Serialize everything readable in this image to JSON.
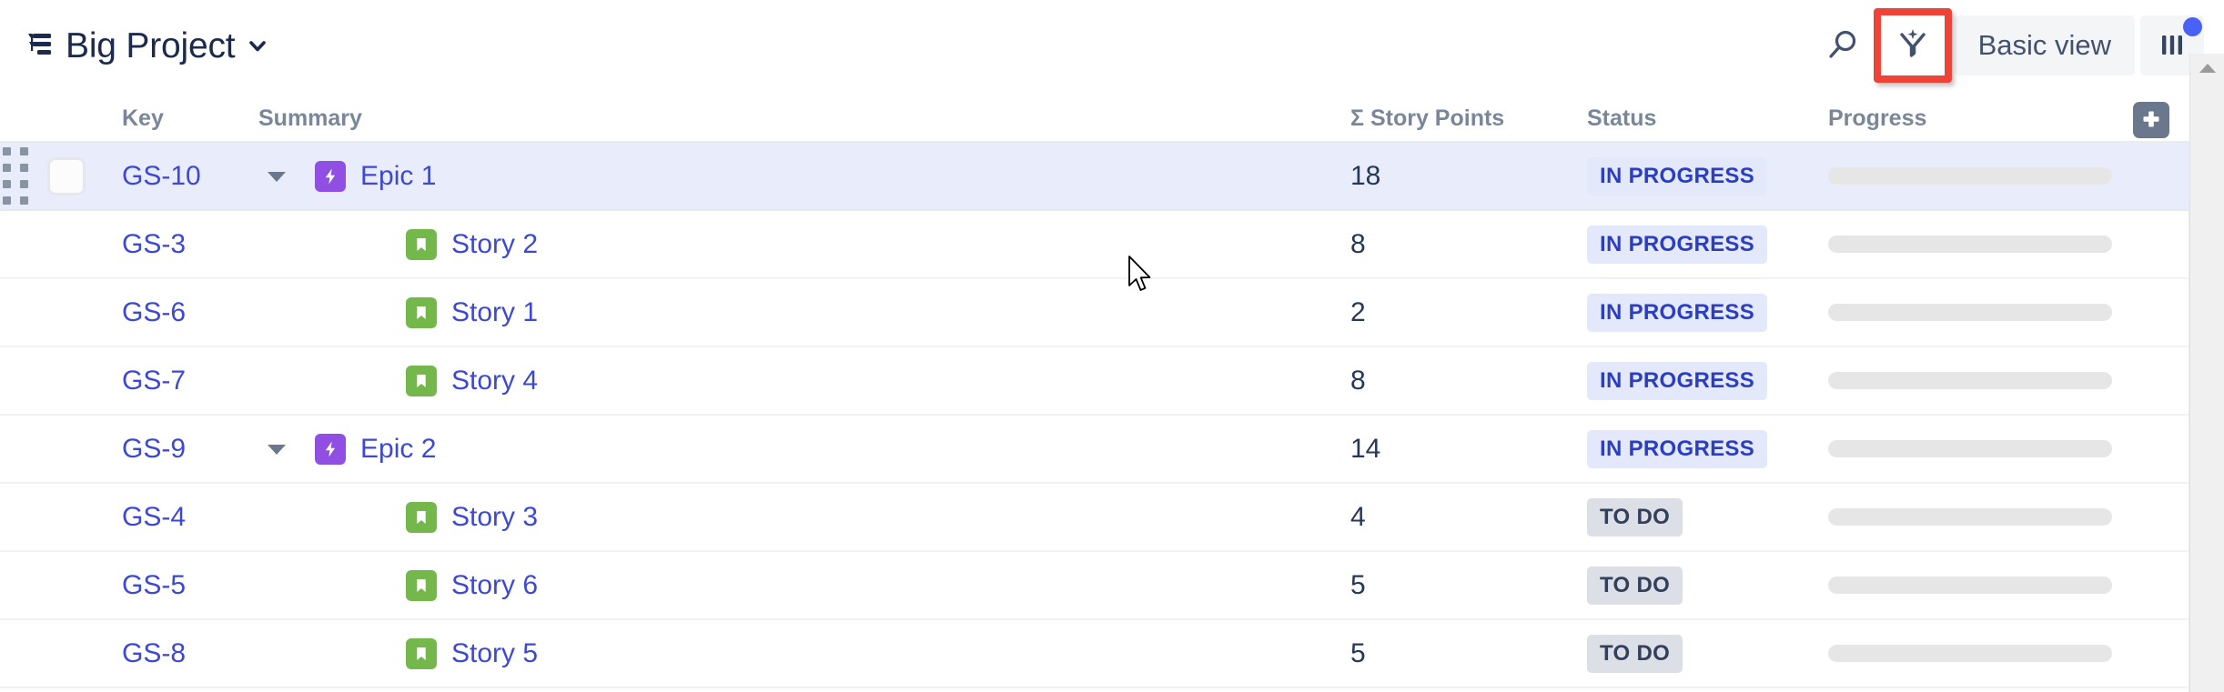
{
  "header": {
    "hierarchy_icon": "hierarchy-list-icon",
    "project_title": "Big Project",
    "title_chevron_icon": "chevron-down-icon",
    "search_icon": "search-icon",
    "filter_icon": "smart-filter-icon",
    "filter_highlight_color": "#f04337",
    "basic_view_label": "Basic view",
    "columns_icon": "columns-icon",
    "columns_badge_color": "#4762f4"
  },
  "table": {
    "columns": [
      {
        "key": "key",
        "label": "Key"
      },
      {
        "key": "summary",
        "label": "Summary"
      },
      {
        "key": "points",
        "label": "Σ Story Points"
      },
      {
        "key": "status",
        "label": "Status"
      },
      {
        "key": "progress",
        "label": "Progress"
      }
    ],
    "add_column_icon": "plus-icon",
    "rows": [
      {
        "key": "GS-10",
        "summary": "Epic 1",
        "type": "epic",
        "type_icon": "epic-bolt-icon",
        "indent": false,
        "expandable": true,
        "expander_icon": "caret-down-icon",
        "points": "18",
        "status": "IN PROGRESS",
        "status_kind": "inprogress",
        "progress_percent": 0,
        "selected": true,
        "has_drag_handle": true,
        "has_checkbox": true
      },
      {
        "key": "GS-3",
        "summary": "Story 2",
        "type": "story",
        "type_icon": "story-bookmark-icon",
        "indent": true,
        "expandable": false,
        "expander_icon": "",
        "points": "8",
        "status": "IN PROGRESS",
        "status_kind": "inprogress",
        "progress_percent": 0,
        "selected": false,
        "has_drag_handle": false,
        "has_checkbox": false
      },
      {
        "key": "GS-6",
        "summary": "Story 1",
        "type": "story",
        "type_icon": "story-bookmark-icon",
        "indent": true,
        "expandable": false,
        "expander_icon": "",
        "points": "2",
        "status": "IN PROGRESS",
        "status_kind": "inprogress",
        "progress_percent": 0,
        "selected": false,
        "has_drag_handle": false,
        "has_checkbox": false
      },
      {
        "key": "GS-7",
        "summary": "Story 4",
        "type": "story",
        "type_icon": "story-bookmark-icon",
        "indent": true,
        "expandable": false,
        "expander_icon": "",
        "points": "8",
        "status": "IN PROGRESS",
        "status_kind": "inprogress",
        "progress_percent": 0,
        "selected": false,
        "has_drag_handle": false,
        "has_checkbox": false
      },
      {
        "key": "GS-9",
        "summary": "Epic 2",
        "type": "epic",
        "type_icon": "epic-bolt-icon",
        "indent": false,
        "expandable": true,
        "expander_icon": "caret-down-icon",
        "points": "14",
        "status": "IN PROGRESS",
        "status_kind": "inprogress",
        "progress_percent": 0,
        "selected": false,
        "has_drag_handle": false,
        "has_checkbox": false
      },
      {
        "key": "GS-4",
        "summary": "Story 3",
        "type": "story",
        "type_icon": "story-bookmark-icon",
        "indent": true,
        "expandable": false,
        "expander_icon": "",
        "points": "4",
        "status": "TO DO",
        "status_kind": "todo",
        "progress_percent": 0,
        "selected": false,
        "has_drag_handle": false,
        "has_checkbox": false
      },
      {
        "key": "GS-5",
        "summary": "Story 6",
        "type": "story",
        "type_icon": "story-bookmark-icon",
        "indent": true,
        "expandable": false,
        "expander_icon": "",
        "points": "5",
        "status": "TO DO",
        "status_kind": "todo",
        "progress_percent": 0,
        "selected": false,
        "has_drag_handle": false,
        "has_checkbox": false
      },
      {
        "key": "GS-8",
        "summary": "Story 5",
        "type": "story",
        "type_icon": "story-bookmark-icon",
        "indent": true,
        "expandable": false,
        "expander_icon": "",
        "points": "5",
        "status": "TO DO",
        "status_kind": "todo",
        "progress_percent": 0,
        "selected": false,
        "has_drag_handle": false,
        "has_checkbox": false
      }
    ]
  },
  "scrollbar": {
    "up_arrow_icon": "caret-up-icon"
  },
  "cursor": {
    "icon": "arrow-cursor"
  },
  "colors": {
    "epic": "#904ee2",
    "story": "#74b74a",
    "link": "#3d48d4",
    "selected_row": "#e9edfb",
    "header_text": "#7a869a"
  }
}
